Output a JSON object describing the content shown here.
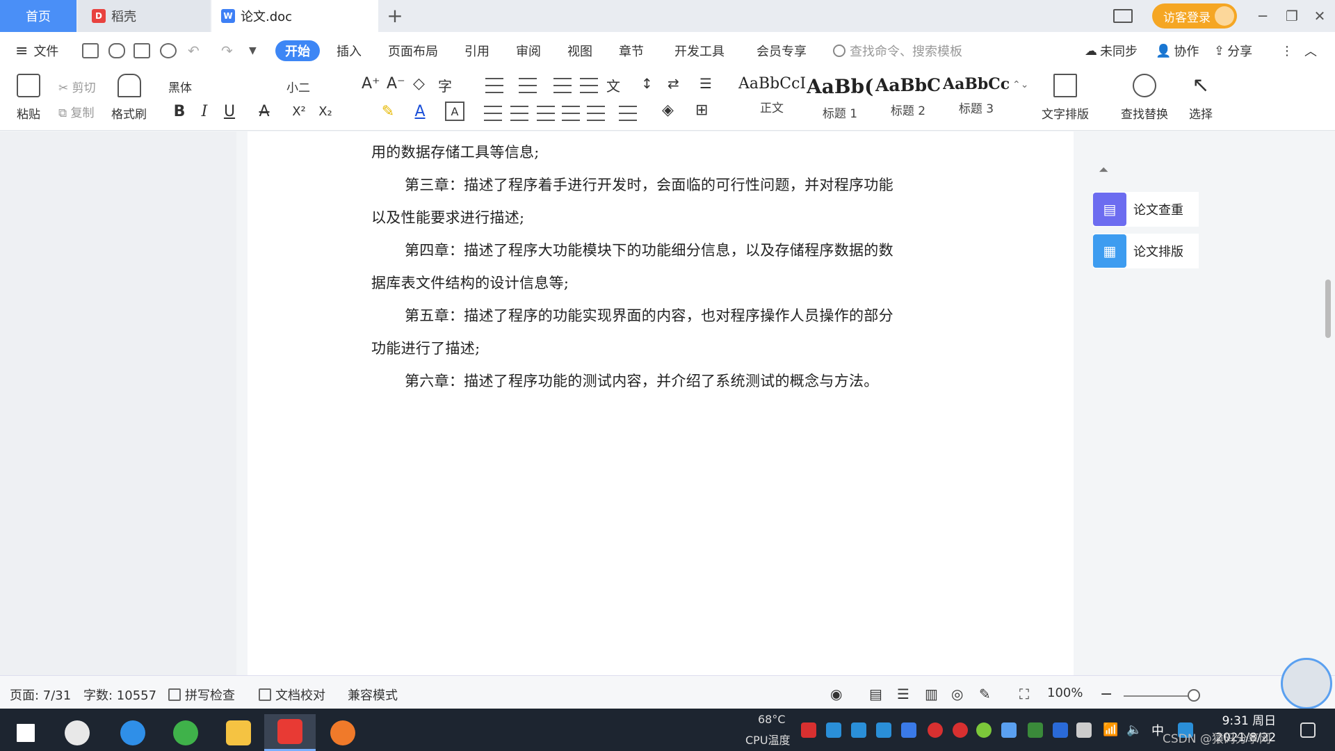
{
  "tabs": {
    "home": "首页",
    "daoke": "稻壳",
    "doc": "论文.doc",
    "add": "+"
  },
  "titlebar": {
    "visitor_login": "访客登录",
    "minimize": "─",
    "restore": "❐",
    "close": "✕"
  },
  "menu": {
    "file": "文件",
    "start": "开始",
    "insert": "插入",
    "page_layout": "页面布局",
    "reference": "引用",
    "review": "审阅",
    "view": "视图",
    "chapter": "章节",
    "dev_tools": "开发工具",
    "member": "会员专享",
    "search_placeholder": "查找命令、搜索模板",
    "unsync": "未同步",
    "collab": "协作",
    "share": "分享"
  },
  "ribbon": {
    "paste": "粘贴",
    "cut": "剪切",
    "copy": "复制",
    "format_painter": "格式刷",
    "font_name": "黑体",
    "font_size": "小二",
    "bold": "B",
    "italic": "I",
    "underline": "U",
    "styles": [
      {
        "sample": "AaBbCcI",
        "name": "正文"
      },
      {
        "sample": "AaBb(",
        "name": "标题 1"
      },
      {
        "sample": "AaBbC",
        "name": "标题 2"
      },
      {
        "sample": "AaBbCcl",
        "name": "标题 3"
      }
    ],
    "text_layout": "文字排版",
    "find_replace": "查找替换",
    "select": "选择"
  },
  "document": {
    "paragraphs": [
      "用的数据存储工具等信息;",
      "第三章：描述了程序着手进行开发时，会面临的可行性问题，并对程序功能",
      "以及性能要求进行描述;",
      "第四章：描述了程序大功能模块下的功能细分信息，以及存储程序数据的数",
      "据库表文件结构的设计信息等;",
      "第五章：描述了程序的功能实现界面的内容，也对程序操作人员操作的部分",
      "功能进行了描述;",
      "第六章：描述了程序功能的测试内容，并介绍了系统测试的概念与方法。"
    ]
  },
  "side_tools": {
    "check": "论文查重",
    "layout": "论文排版"
  },
  "status": {
    "page": "页面: 7/31",
    "words": "字数: 10557",
    "spell": "拼写检查",
    "proof": "文档校对",
    "compat": "兼容模式",
    "zoom": "100%"
  },
  "taskbar": {
    "temp": "68°C",
    "cpu": "CPU温度",
    "ime": "中",
    "time": "9:31 周日",
    "date": "2021/8/22",
    "watermark": "CSDN @猿码分享网"
  },
  "colors": {
    "accent": "#3d86f5",
    "home_tab": "#4a8ff7",
    "visitor": "#f5a623",
    "taskbar": "#1d2530"
  }
}
